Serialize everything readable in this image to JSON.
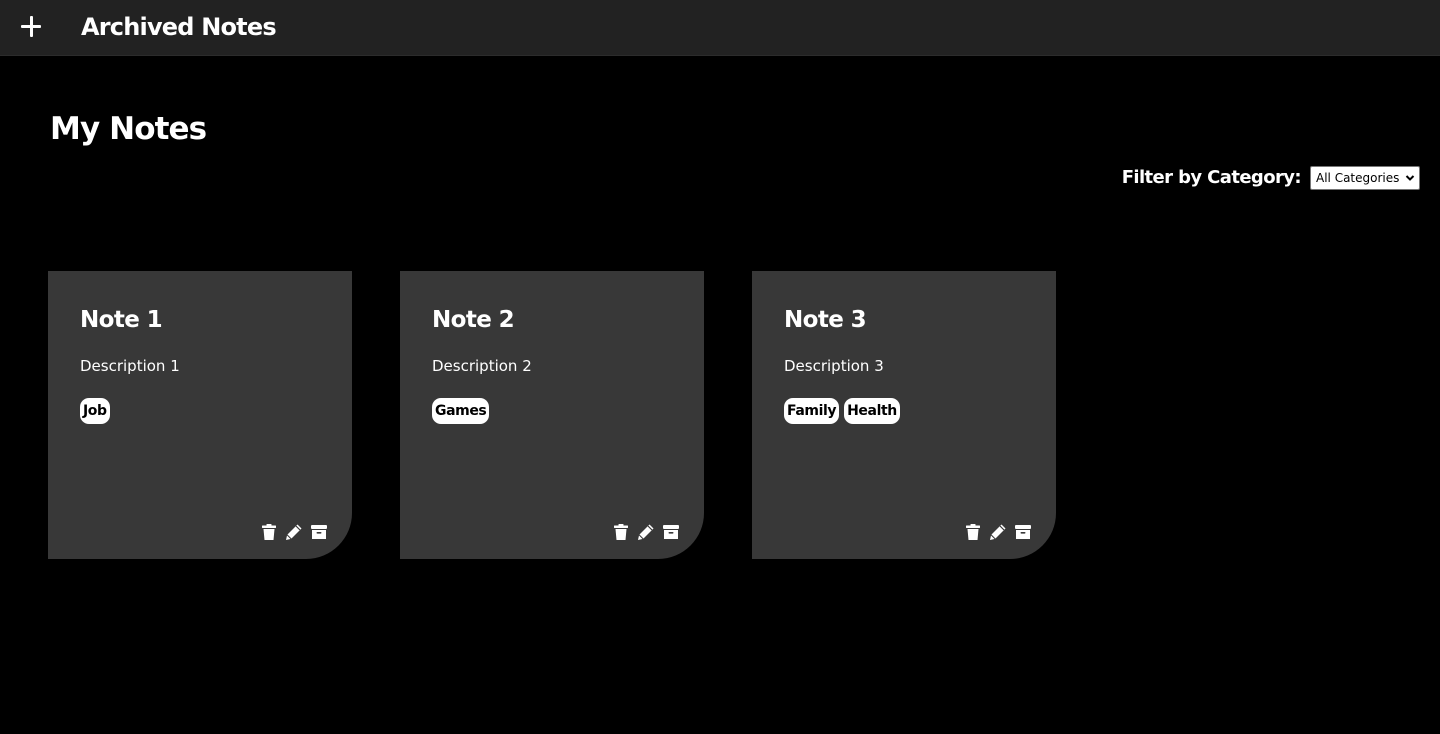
{
  "header": {
    "add_icon": "plus-icon",
    "archived_label": "Archived Notes"
  },
  "main": {
    "title": "My Notes",
    "filter": {
      "label": "Filter by Category:",
      "selected": "All Categories"
    }
  },
  "notes": [
    {
      "title": "Note 1",
      "description": "Description 1",
      "tags": [
        "Job"
      ]
    },
    {
      "title": "Note 2",
      "description": "Description 2",
      "tags": [
        "Games"
      ]
    },
    {
      "title": "Note 3",
      "description": "Description 3",
      "tags": [
        "Family",
        "Health"
      ]
    }
  ],
  "note_actions": [
    "trash-icon",
    "pencil-icon",
    "archive-icon"
  ],
  "colors": {
    "background": "#000000",
    "header": "#222222",
    "card": "#383838",
    "tag_bg": "#ffffff",
    "text": "#ffffff"
  }
}
